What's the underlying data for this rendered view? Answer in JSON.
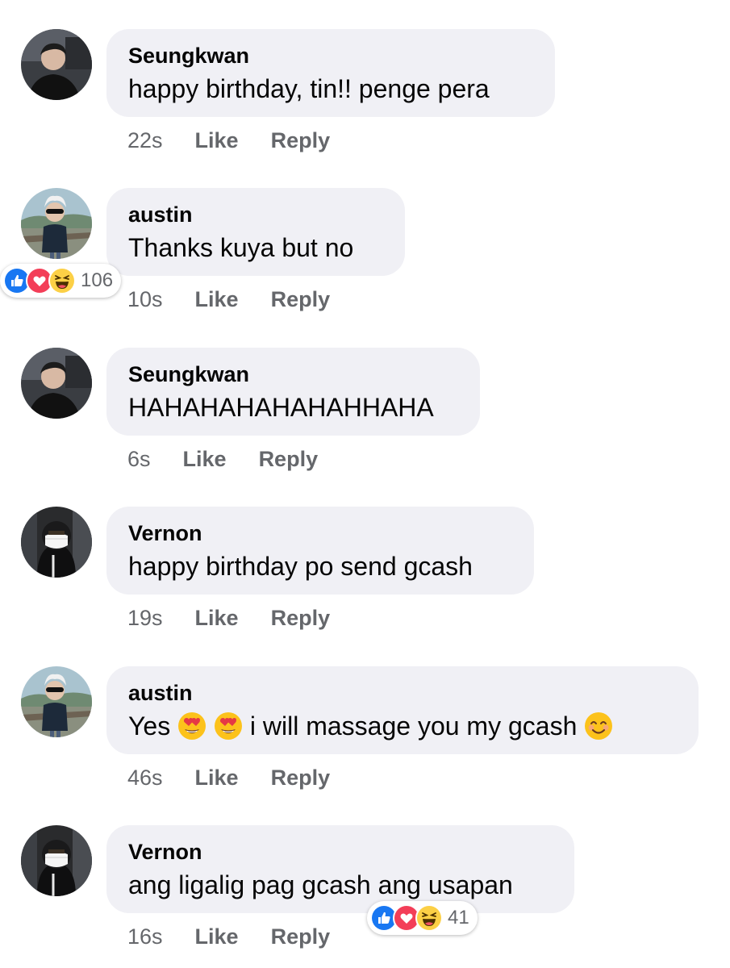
{
  "colors": {
    "bubble_bg": "#f0f0f5",
    "meta_text": "#65676b",
    "like_blue": "#1877f2",
    "love_red": "#f33e58",
    "haha_yellow": "#fcd046"
  },
  "comments": [
    {
      "author": "Seungkwan",
      "avatar_icon": "seungkwan-avatar",
      "text_parts": [
        "happy birthday, tin!! penge pera"
      ],
      "time": "22s",
      "like_label": "Like",
      "reply_label": "Reply"
    },
    {
      "author": "austin",
      "avatar_icon": "austin-avatar",
      "text_parts": [
        "Thanks kuya but no"
      ],
      "time": "10s",
      "like_label": "Like",
      "reply_label": "Reply",
      "reactions": {
        "icons": [
          "like-reaction-icon",
          "love-reaction-icon",
          "haha-reaction-icon"
        ],
        "count": "106"
      }
    },
    {
      "author": "Seungkwan",
      "avatar_icon": "seungkwan-avatar",
      "text_parts": [
        "HAHAHAHAHAHAHHAHA"
      ],
      "time": "6s",
      "like_label": "Like",
      "reply_label": "Reply"
    },
    {
      "author": "Vernon",
      "avatar_icon": "vernon-avatar",
      "text_parts": [
        "happy birthday po send gcash"
      ],
      "time": "19s",
      "like_label": "Like",
      "reply_label": "Reply"
    },
    {
      "author": "austin",
      "avatar_icon": "austin-avatar",
      "text_parts": [
        "Yes ",
        "heart-eyes-emoji",
        " ",
        "heart-eyes-emoji",
        " i will massage you my gcash ",
        "smiling-emoji"
      ],
      "time": "46s",
      "like_label": "Like",
      "reply_label": "Reply"
    },
    {
      "author": "Vernon",
      "avatar_icon": "vernon-avatar",
      "text_parts": [
        "ang ligalig pag gcash ang usapan"
      ],
      "time": "16s",
      "like_label": "Like",
      "reply_label": "Reply",
      "reactions": {
        "icons": [
          "like-reaction-icon",
          "love-reaction-icon",
          "haha-reaction-icon"
        ],
        "count": "41"
      }
    }
  ]
}
